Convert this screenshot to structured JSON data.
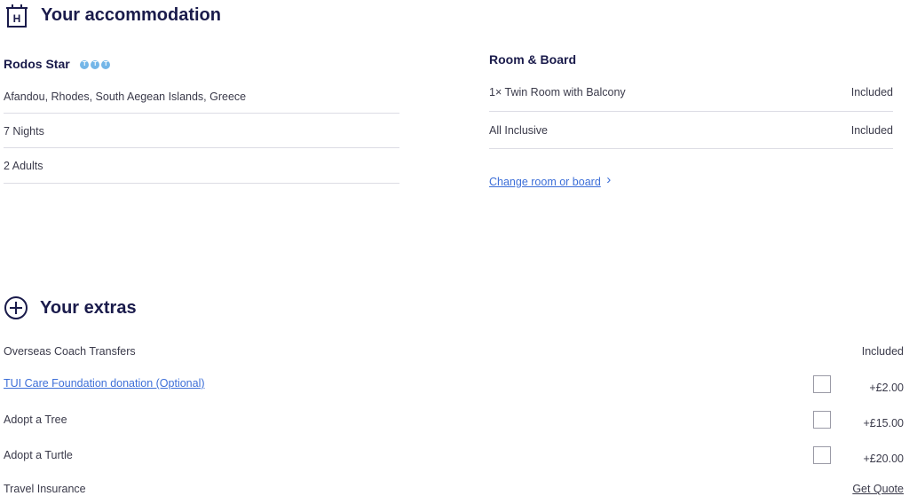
{
  "accommodation": {
    "heading": "Your accommodation",
    "hotel_name": "Rodos Star",
    "rating_icon": "tui-rating-dot-icon",
    "location": "Afandou, Rhodes, South Aegean Islands, Greece",
    "nights": "7 Nights",
    "guests": "2  Adults"
  },
  "room_board": {
    "title": "Room & Board",
    "items": [
      {
        "label": "1× Twin Room with Balcony",
        "status": "Included"
      },
      {
        "label": "All Inclusive",
        "status": "Included"
      }
    ],
    "change_link": "Change room or board",
    "change_chevron": "›"
  },
  "extras": {
    "heading": "Your extras",
    "icon": "plus-circle-icon",
    "items": [
      {
        "label": "Overseas Coach Transfers",
        "value": "Included"
      },
      {
        "label": "TUI Care Foundation donation (Optional)",
        "value": "+£2.00"
      },
      {
        "label": "Adopt a Tree",
        "value": "+£15.00"
      },
      {
        "label": "Adopt a Turtle",
        "value": "+£20.00"
      },
      {
        "label": "Travel Insurance",
        "value": "Get Quote"
      }
    ]
  },
  "colors": {
    "heading": "#1a1b4b",
    "link": "#3d6fd8",
    "rating": "#73b6e8",
    "divider": "#dcdce4"
  }
}
